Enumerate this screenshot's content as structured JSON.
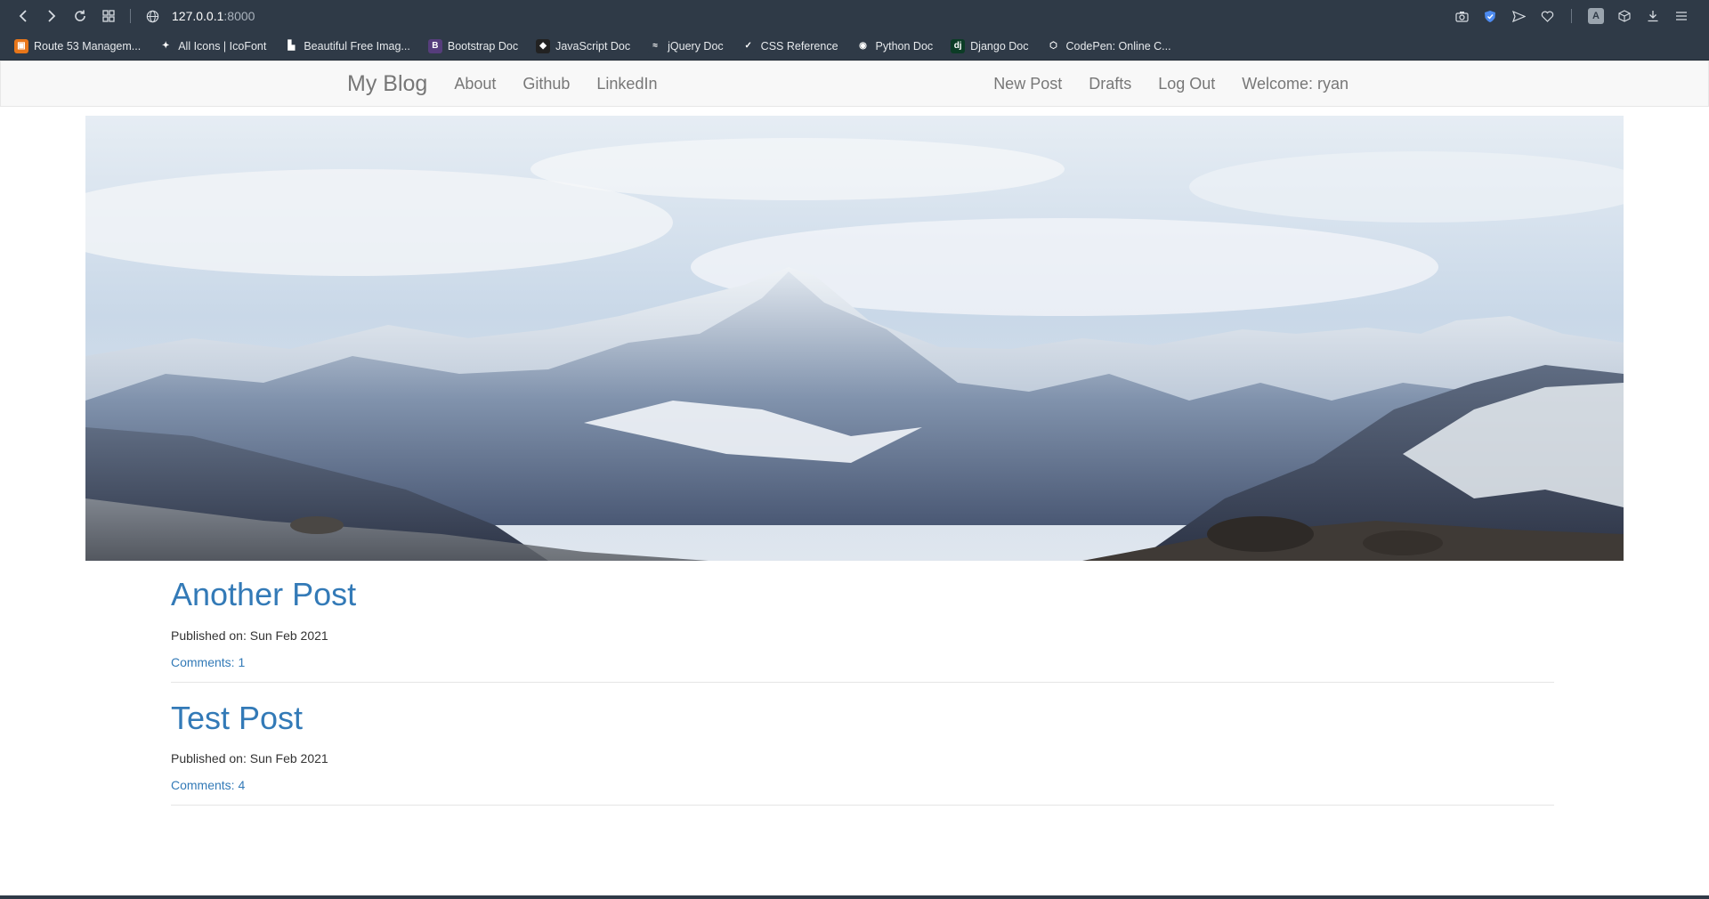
{
  "browser": {
    "url_host": "127.0.0.1",
    "url_port": ":8000",
    "bookmarks": [
      {
        "label": "Route 53 Managem...",
        "icon": "aws-icon",
        "color": "#ff9900"
      },
      {
        "label": "All Icons | IcoFont",
        "icon": "icofont-icon",
        "color": "#2f3a47"
      },
      {
        "label": "Beautiful Free Imag...",
        "icon": "unsplash-icon",
        "color": "#2f3a47"
      },
      {
        "label": "Bootstrap Doc",
        "icon": "bootstrap-icon",
        "color": "#2f3a47"
      },
      {
        "label": "JavaScript Doc",
        "icon": "javascript-icon",
        "color": "#2f3a47"
      },
      {
        "label": "jQuery Doc",
        "icon": "jquery-icon",
        "color": "#2f3a47"
      },
      {
        "label": "CSS Reference",
        "icon": "css-icon",
        "color": "#2f3a47"
      },
      {
        "label": "Python Doc",
        "icon": "python-icon",
        "color": "#2f3a47"
      },
      {
        "label": "Django Doc",
        "icon": "django-icon",
        "color": "#2f3a47"
      },
      {
        "label": "CodePen: Online C...",
        "icon": "codepen-icon",
        "color": "#2f3a47"
      }
    ]
  },
  "navbar": {
    "brand": "My Blog",
    "left_links": [
      "About",
      "Github",
      "LinkedIn"
    ],
    "right_links": [
      "New Post",
      "Drafts",
      "Log Out"
    ],
    "welcome": "Welcome: ryan"
  },
  "posts": [
    {
      "title": "Another Post",
      "published": "Published on: Sun Feb 2021",
      "comments": "Comments: 1"
    },
    {
      "title": "Test Post",
      "published": "Published on: Sun Feb 2021",
      "comments": "Comments: 4"
    }
  ],
  "colors": {
    "link": "#337ab7",
    "chrome_bg": "#2f3a47",
    "navbar_bg": "#f8f8f8"
  }
}
